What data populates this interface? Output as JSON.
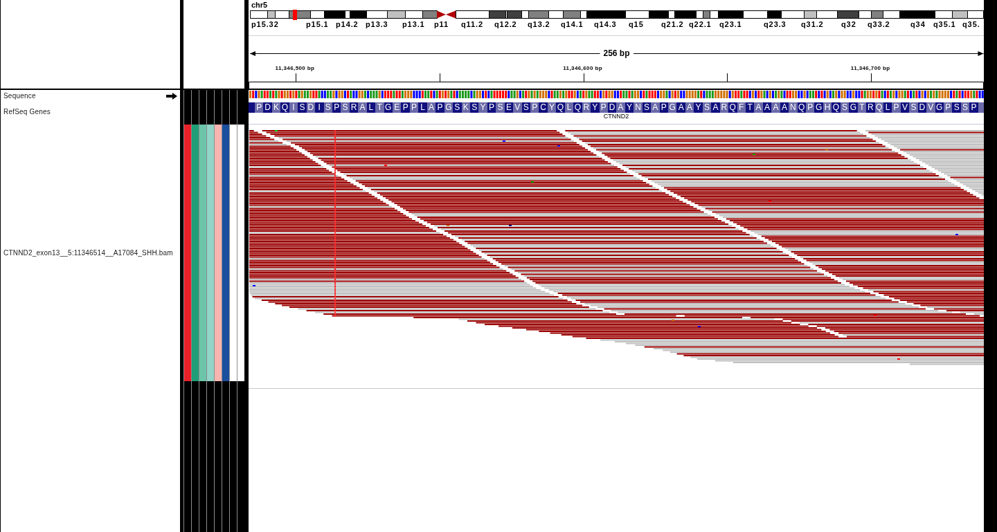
{
  "locus": {
    "chromosome": "chr5",
    "band_labels": [
      "p15.32",
      "p15.1",
      "p14.2",
      "p13.3",
      "p13.1",
      "p11",
      "q11.2",
      "q12.2",
      "q13.2",
      "q14.1",
      "q14.3",
      "q15",
      "q21.2",
      "q22.1",
      "q23.1",
      "q23.3",
      "q31.2",
      "q32",
      "q33.2",
      "q34",
      "q35.1",
      "q35."
    ],
    "span": "256 bp",
    "ticks": [
      "11,346,500 bp",
      "11,346,600 bp",
      "11,346,700 bp"
    ]
  },
  "tracks": [
    {
      "kind": "sequence",
      "name": "Sequence",
      "forward_strand": true
    },
    {
      "kind": "gene",
      "name": "RefSeq Genes",
      "amino_acids": [
        "P",
        "D",
        "K",
        "Q",
        "I",
        "S",
        "D",
        "I",
        "S",
        "P",
        "S",
        "R",
        "A",
        "L",
        "T",
        "G",
        "E",
        "P",
        "P",
        "L",
        "A",
        "P",
        "G",
        "S",
        "K",
        "S",
        "Y",
        "P",
        "S",
        "E",
        "V",
        "S",
        "P",
        "C",
        "Y",
        "Q",
        "L",
        "Q",
        "R",
        "Y",
        "P",
        "D",
        "A",
        "Y",
        "N",
        "S",
        "A",
        "P",
        "G",
        "A",
        "A",
        "Y",
        "S",
        "A",
        "R",
        "Q",
        "F",
        "T",
        "A",
        "A",
        "A",
        "A",
        "N",
        "Q",
        "P",
        "G",
        "H",
        "Q",
        "S",
        "G",
        "T",
        "R",
        "Q",
        "L",
        "P",
        "V",
        "S",
        "D",
        "V",
        "G",
        "P",
        "S",
        "S",
        "P"
      ],
      "gene": "CTNND2"
    },
    {
      "kind": "alignment",
      "name": "CTNND2_exon13__5:11346514__A17084_SHH.bam",
      "attributes": [
        {
          "color": "#e8202a"
        },
        {
          "color": "#1f9e78"
        },
        {
          "color": "#6cc5a8"
        },
        {
          "color": "#93d4c8"
        },
        {
          "color": "#f8b5b0"
        },
        {
          "color": "#1b4f9e"
        },
        {
          "color": "#ffffff"
        },
        {
          "color": "#ffffff"
        }
      ]
    }
  ]
}
